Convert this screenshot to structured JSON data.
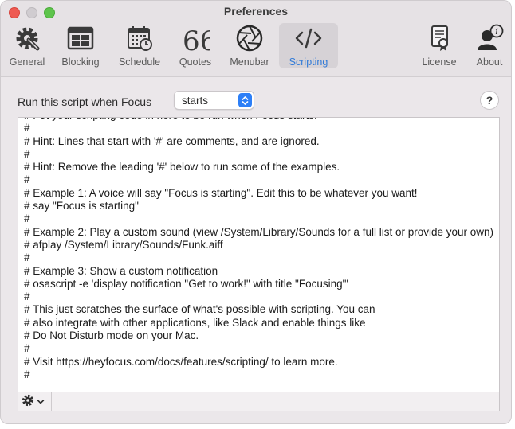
{
  "window": {
    "title": "Preferences"
  },
  "toolbar": {
    "items": [
      {
        "label": "General",
        "icon": "gear-wrench-icon"
      },
      {
        "label": "Blocking",
        "icon": "window-grid-icon"
      },
      {
        "label": "Schedule",
        "icon": "calendar-clock-icon"
      },
      {
        "label": "Quotes",
        "icon": "quote-marks-icon"
      },
      {
        "label": "Menubar",
        "icon": "aperture-icon"
      },
      {
        "label": "Scripting",
        "icon": "code-brackets-icon",
        "selected": true
      },
      {
        "label": "License",
        "icon": "certificate-icon"
      },
      {
        "label": "About",
        "icon": "person-info-icon"
      }
    ]
  },
  "trigger": {
    "label": "Run this script when Focus",
    "selected": "starts"
  },
  "help": {
    "symbol": "?"
  },
  "script": {
    "lines": [
      "# Put your scripting code in here to be run when Focus starts.",
      "#",
      "# Hint: Lines that start with '#' are comments, and are ignored.",
      "#",
      "# Hint: Remove the leading '#' below to run some of the examples.",
      "#",
      "# Example 1: A voice will say \"Focus is starting\". Edit this to be whatever you want!",
      "# say \"Focus is starting\"",
      "#",
      "# Example 2: Play a custom sound (view /System/Library/Sounds for a full list or provide your own)",
      "# afplay /System/Library/Sounds/Funk.aiff",
      "#",
      "# Example 3: Show a custom notification",
      "# osascript -e 'display notification \"Get to work!\" with title \"Focusing\"'",
      "#",
      "# This just scratches the surface of what's possible with scripting. You can",
      "# also integrate with other applications, like Slack and enable things like",
      "# Do Not Disturb mode on your Mac.",
      "#",
      "# Visit https://heyfocus.com/docs/features/scripting/ to learn more.",
      "#"
    ]
  },
  "colors": {
    "accent": "#2f7ad9",
    "select_button": "#2d7ff7"
  }
}
